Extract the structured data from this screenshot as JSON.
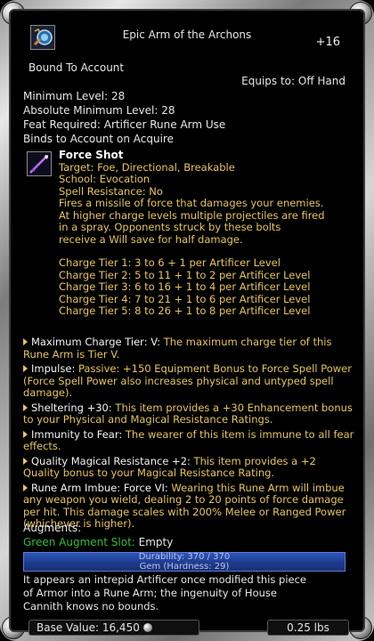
{
  "item": {
    "title": "Epic Arm of the Archons",
    "level": "+16",
    "bound": "Bound To Account",
    "equips": "Equips to: Off Hand",
    "icon": "rune-arm-icon"
  },
  "requirements": [
    "Minimum Level: 28",
    "Absolute Minimum Level: 28",
    "Feat Required: Artificer Rune Arm Use",
    "Binds to Account on Acquire"
  ],
  "spell": {
    "icon": "force-shot-icon",
    "name": "Force Shot",
    "target": "Target: Foe, Directional, Breakable",
    "school": "School: Evocation",
    "resistance": "Spell Resistance: No",
    "description": [
      "Fires a missile of force that damages your enemies.",
      "At higher charge levels multiple projectiles are fired",
      "in a spray. Opponents struck by these bolts",
      "receive a Will save for half damage."
    ],
    "tiers": [
      "Charge Tier 1: 3 to 6 + 1 per Artificer Level",
      "Charge Tier 2: 5 to 11 + 1 to 2 per Artificer Level",
      "Charge Tier 3: 6 to 16 + 1 to 4 per Artificer Level",
      "Charge Tier 4: 7 to 21 + 1 to 6 per Artificer Level",
      "Charge Tier 5: 8 to 26 + 1 to 8 per Artificer Level"
    ]
  },
  "effects": [
    {
      "name": "Maximum Charge Tier: V:",
      "desc": " The maximum charge tier of this Rune Arm is Tier V."
    },
    {
      "name": "Impulse:",
      "desc": " Passive: +150 Equipment Bonus to Force Spell Power (Force Spell Power also increases physical and untyped spell damage)."
    },
    {
      "name": "Sheltering +30:",
      "desc": " This item provides a +30 Enhancement bonus to your Physical and Magical Resistance Ratings."
    },
    {
      "name": "Immunity to Fear:",
      "desc": " The wearer of this item is immune to all fear effects."
    },
    {
      "name": "Quality Magical Resistance +2:",
      "desc": " This item provides a +2 Quality bonus to your Magical Resistance Rating."
    },
    {
      "name": "Rune Arm Imbue: Force VI:",
      "desc": " Wearing this Rune Arm will imbue any weapon you wield, dealing 2 to 20 points of force damage per hit. This damage scales with 200% Melee or Ranged Power (whichever is higher)."
    }
  ],
  "augments": {
    "header": "Augments:",
    "slot_label": "Green Augment Slot:",
    "slot_value": " Empty"
  },
  "durability": {
    "text": "Durability: 370 / 370",
    "gem": "Gem (Hardness: 29)",
    "fraction": 1.0
  },
  "flavor": [
    "It appears an intrepid Artificer once modified this piece",
    "of Armor into a Rune Arm; the ingenuity of House",
    "Cannith knows no bounds."
  ],
  "footer": {
    "base_value": "Base Value: 16,450",
    "weight": "0.25 lbs"
  },
  "colors": {
    "effect_text": "#e5c65a",
    "augment_green": "#2fbf2f",
    "durability_blue": "#2f56b8"
  }
}
